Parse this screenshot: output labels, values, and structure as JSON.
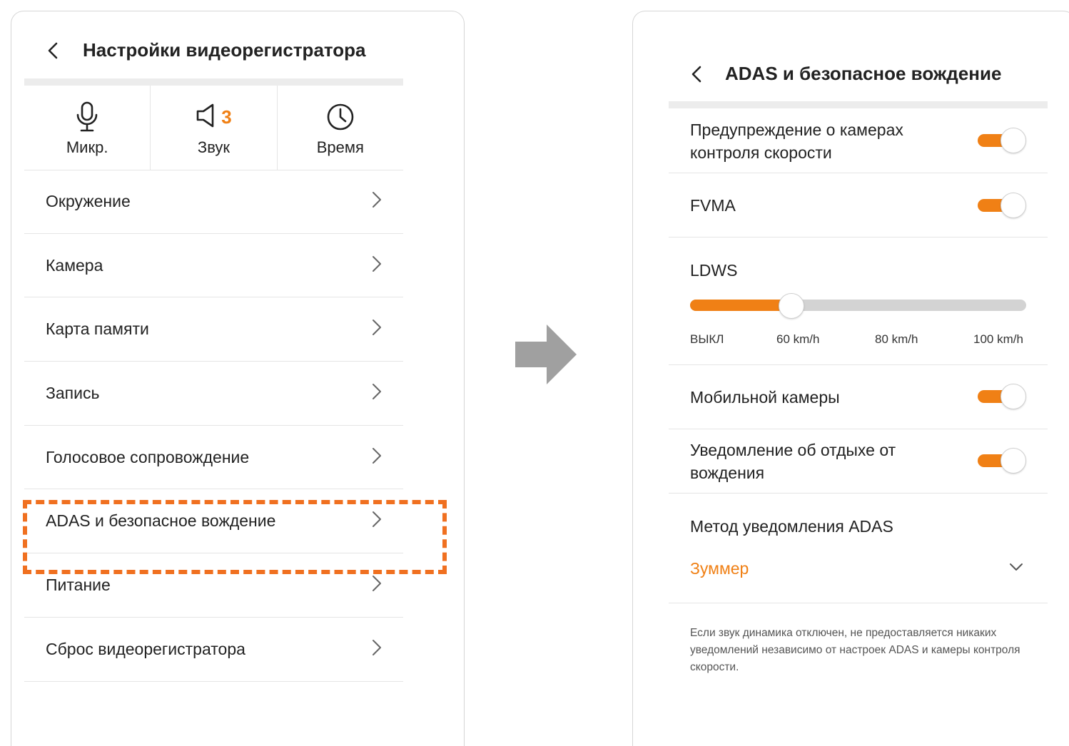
{
  "left": {
    "title": "Настройки видеорегистратора",
    "quick": [
      {
        "label": "Микр.",
        "icon": "microphone-icon"
      },
      {
        "label": "Звук",
        "icon": "speaker-icon",
        "badge": "3"
      },
      {
        "label": "Время",
        "icon": "clock-icon"
      }
    ],
    "menu": [
      {
        "label": "Окружение"
      },
      {
        "label": "Камера"
      },
      {
        "label": "Карта памяти"
      },
      {
        "label": "Запись"
      },
      {
        "label": "Голосовое сопровождение"
      },
      {
        "label": "ADAS и безопасное вождение"
      },
      {
        "label": "Питание"
      },
      {
        "label": "Сброс видеорегистратора"
      }
    ],
    "highlighted_item": "ADAS и безопасное вождение"
  },
  "right": {
    "title": "ADAS и безопасное вождение",
    "speed_camera": {
      "label": "Предупреждение о камерах контроля скорости",
      "on": true
    },
    "fvma": {
      "label": "FVMA",
      "on": true
    },
    "ldws": {
      "label": "LDWS",
      "ticks": [
        "ВЫКЛ",
        "60 km/h",
        "80 km/h",
        "100 km/h"
      ],
      "selected": "60 km/h",
      "level": 0.3
    },
    "mobile_camera": {
      "label": "Мобильной камеры",
      "on": true
    },
    "rest": {
      "label": "Уведомление об отдыхе от вождения",
      "on": true
    },
    "method": {
      "label": "Метод уведомления ADAS",
      "value": "Зуммер"
    },
    "note": "Если звук динамика отключен, не предоставляется никаких уведомлений независимо от настроек ADAS и камеры контроля скорости."
  },
  "colors": {
    "accent": "#f08015",
    "highlight": "#f07020",
    "arrow": "#a0a0a0"
  }
}
